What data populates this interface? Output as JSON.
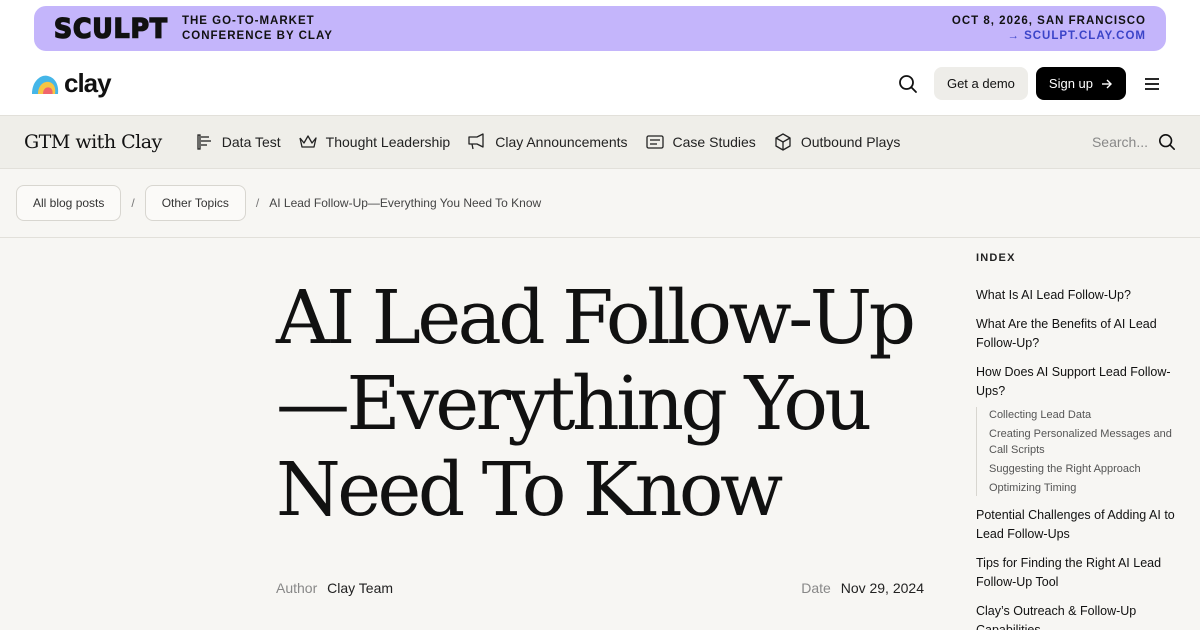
{
  "promo": {
    "logo": "SCULPT",
    "line1": "THE GO-TO-MARKET",
    "line2": "CONFERENCE BY CLAY",
    "date_line": "OCT 8, 2026, SAN FRANCISCO",
    "link": "→ SCULPT.CLAY.COM",
    "bg_color": "#c4b5fb"
  },
  "header": {
    "logo_text": "clay",
    "search_icon": "search-icon",
    "demo_label": "Get a demo",
    "signup_label": "Sign up",
    "menu_icon": "hamburger-menu-icon"
  },
  "blognav": {
    "title": "GTM with Clay",
    "items": [
      {
        "label": "Data Test",
        "icon": "data-test-icon"
      },
      {
        "label": "Thought Leadership",
        "icon": "crown-icon"
      },
      {
        "label": "Clay Announcements",
        "icon": "megaphone-icon"
      },
      {
        "label": "Case Studies",
        "icon": "card-icon"
      },
      {
        "label": "Outbound Plays",
        "icon": "cube-icon"
      }
    ],
    "search_placeholder": "Search..."
  },
  "breadcrumb": {
    "items": [
      "All blog posts",
      "Other Topics"
    ],
    "separator": "/",
    "current": "AI Lead Follow-Up—Everything You Need To Know"
  },
  "article": {
    "title_lines": [
      "AI Lead Follow-Up",
      "—Everything You",
      "Need To Know"
    ],
    "author_label": "Author",
    "author": "Clay Team",
    "date_label": "Date",
    "date": "Nov 29, 2024"
  },
  "index": {
    "title": "INDEX",
    "items": [
      {
        "label": "What Is AI Lead Follow-Up?"
      },
      {
        "label": "What Are the Benefits of AI Lead Follow-Up?"
      },
      {
        "label": "How Does AI Support Lead Follow-Ups?",
        "subitems": [
          "Collecting Lead Data",
          "Creating Personalized Messages and Call Scripts",
          "Suggesting the Right Approach",
          "Optimizing Timing"
        ]
      },
      {
        "label": "Potential Challenges of Adding AI to Lead Follow-Ups"
      },
      {
        "label": "Tips for Finding the Right AI Lead Follow-Up Tool"
      },
      {
        "label": "Clay’s Outreach & Follow-Up Capabilities"
      }
    ]
  }
}
